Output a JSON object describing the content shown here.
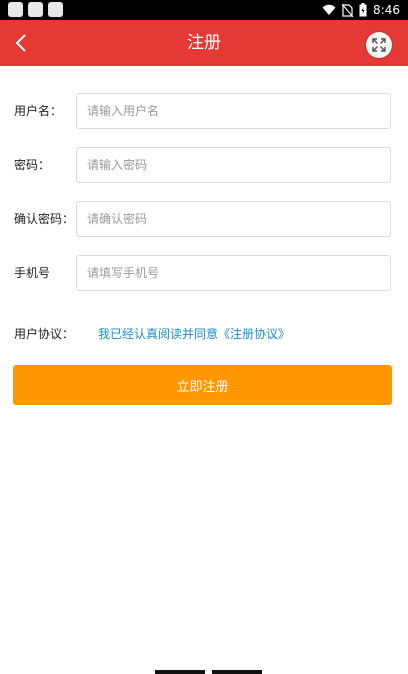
{
  "status_bar": {
    "time": "8:46",
    "icons": [
      "wifi-icon",
      "no-sim-icon",
      "battery-charging-icon"
    ]
  },
  "header": {
    "title": "注册",
    "back_icon": "chevron-left-icon",
    "expand_icon": "expand-icon"
  },
  "form": {
    "fields": [
      {
        "label": "用户名：",
        "placeholder": "请输入用户名",
        "value": ""
      },
      {
        "label": "密码：",
        "placeholder": "请输入密码",
        "value": ""
      },
      {
        "label": "确认密码：",
        "placeholder": "请确认密码",
        "value": ""
      },
      {
        "label": "手机号",
        "placeholder": "请填写手机号",
        "value": ""
      }
    ]
  },
  "agreement": {
    "label": "用户协议：",
    "link_text": "我已经认真阅读并同意《注册协议》"
  },
  "submit": {
    "label": "立即注册"
  },
  "colors": {
    "header_bg": "#e53935",
    "button_bg": "#ff9800",
    "link": "#1a8fc9"
  }
}
